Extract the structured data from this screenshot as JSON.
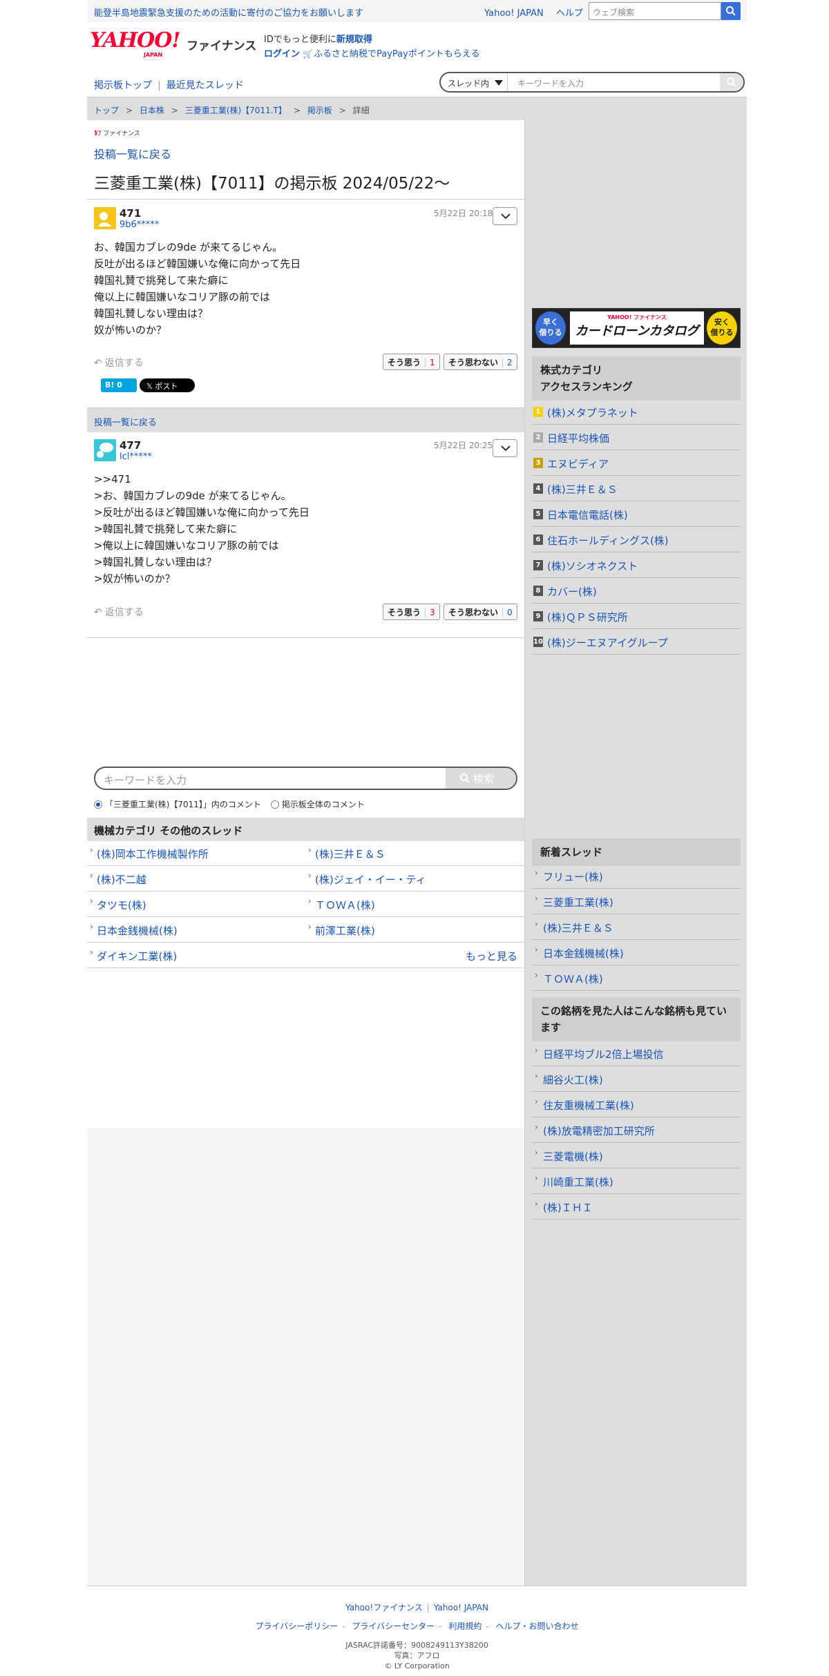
{
  "topbar": {
    "notice": "能登半島地震緊急支援のための活動に寄付のご協力をお願いします",
    "links": [
      "Yahoo! JAPAN",
      "ヘルプ"
    ],
    "search_placeholder": "ウェブ検索"
  },
  "header": {
    "logo_main": "YAHOO!",
    "logo_sub": "JAPAN",
    "logo_service": "ファイナンス",
    "id_prefix": "IDでもっと便利に",
    "signup": "新規取得",
    "login": "ログイン",
    "promo": "ふるさと納税でPayPayポイントもらえる"
  },
  "nav": {
    "board_top": "掲示板トップ",
    "recent": "最近見たスレッド",
    "scope": "スレッド内",
    "keyword_placeholder": "キーワードを入力"
  },
  "breadcrumb": [
    "トップ",
    "日本株",
    "三菱重工業(株)【7011.T】",
    "掲示板",
    "詳細"
  ],
  "main": {
    "small_logo_y": "Y!",
    "small_logo_text": "ファイナンス",
    "back_label": "投稿一覧に戻る",
    "title": "三菱重工業(株)【7011】の掲示板 2024/05/22〜",
    "reply_label": "返信する",
    "agree_label": "そう思う",
    "disagree_label": "そう思わない",
    "hatena_label": "B! 0",
    "x_label": "𝕏 ポスト",
    "posts": [
      {
        "number": "471",
        "user": "9b6*****",
        "date": "5月22日 20:18",
        "body": "お、韓国カブレの9de が来てるじゃん。\n反吐が出るほど韓国嫌いな俺に向かって先日\n韓国礼賛で挑発して来た癖に\n俺以上に韓国嫌いなコリア豚の前では\n韓国礼賛しない理由は？\n奴が怖いのか？",
        "agree": "1",
        "disagree": "2"
      },
      {
        "number": "477",
        "user": "lcl*****",
        "date": "5月22日 20:25",
        "body": ">>471\n>お、韓国カブレの9de が来てるじゃん。\n>反吐が出るほど韓国嫌いな俺に向かって先日\n>韓国礼賛で挑発して来た癖に\n>俺以上に韓国嫌いなコリア豚の前では\n>韓国礼賛しない理由は？\n>奴が怖いのか？",
        "agree": "3",
        "disagree": "0"
      }
    ],
    "search_placeholder": "キーワードを入力",
    "search_button": "検索",
    "radio_thread": "「三菱重工業(株)【7011】」内のコメント",
    "radio_all": "掲示板全体のコメント",
    "other_threads_title": "機械カテゴリ  その他のスレッド",
    "other_threads": [
      "(株)岡本工作機械製作所",
      "(株)三井Ｅ＆Ｓ",
      "(株)不二越",
      "(株)ジェイ・イー・ティ",
      "タツモ(株)",
      "ＴＯＷＡ(株)",
      "日本金銭機械(株)",
      "前澤工業(株)",
      "ダイキン工業(株)"
    ],
    "more_label": "もっと見る"
  },
  "side": {
    "ad_left": "早く\n借りる",
    "ad_yj": "YAHOO! ファイナンス",
    "ad_title": "カードローンカタログ",
    "ad_right": "安く\n借りる",
    "ranking_title_1": "株式カテゴリ",
    "ranking_title_2": "アクセスランキング",
    "ranking": [
      "(株)メタプラネット",
      "日経平均株価",
      "エヌビディア",
      "(株)三井Ｅ＆Ｓ",
      "日本電信電話(株)",
      "住石ホールディングス(株)",
      "(株)ソシオネクスト",
      "カバー(株)",
      "(株)ＱＰＳ研究所",
      "(株)ジーエヌアイグループ"
    ],
    "ranking_nums": [
      "1",
      "2",
      "3",
      "4",
      "5",
      "6",
      "7",
      "8",
      "9",
      "10"
    ],
    "new_title": "新着スレッド",
    "new_threads": [
      "フリュー(株)",
      "三菱重工業(株)",
      "(株)三井Ｅ＆Ｓ",
      "日本金銭機械(株)",
      "ＴＯＷＡ(株)"
    ],
    "also_title": "この銘柄を見た人はこんな銘柄も見ています",
    "also": [
      "日経平均ブル2倍上場投信",
      "細谷火工(株)",
      "住友重機械工業(株)",
      "(株)放電精密加工研究所",
      "三菱電機(株)",
      "川崎重工業(株)",
      "(株)ＩＨＩ"
    ]
  },
  "footer": {
    "links1": [
      "Yahoo!ファイナンス",
      "Yahoo! JAPAN"
    ],
    "links2": [
      "プライバシーポリシー",
      "プライバシーセンター",
      "利用規約",
      "ヘルプ・お問い合わせ"
    ],
    "jasrac": "JASRAC許諾番号：9008249113Y38200",
    "photo": "写真：アフロ",
    "copyright": "© LY Corporation"
  },
  "colors": {
    "accent": "#1a56b8",
    "brand": "#ff0033",
    "sidebar": "#dedede"
  }
}
